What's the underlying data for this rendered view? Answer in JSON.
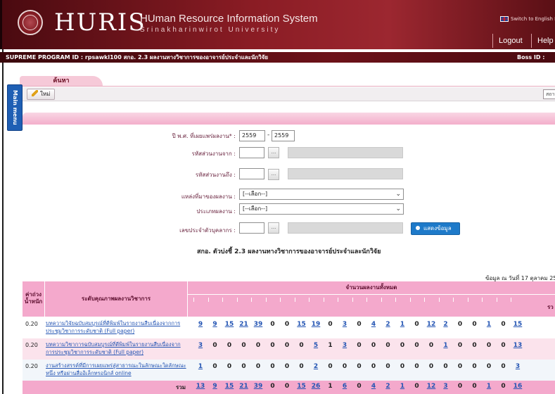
{
  "header": {
    "brand": "HURIS",
    "system_title": "HUman Resource Information System",
    "system_subtitle": "Srinakharinwirot University",
    "language_switch": "Switch to English Language",
    "logout_label": "Logout",
    "help_label": "Help"
  },
  "infobar": {
    "program": "SUPREME  PROGRAM ID : rpsawkl100 สกอ. 2.3 ผลงานทางวิชาการของอาจารย์ประจำและนักวิจัย",
    "boss": "Boss ID :"
  },
  "tab": {
    "label": "ค้นหา"
  },
  "sidemenu": {
    "label": "Main menu"
  },
  "toolbar": {
    "new_label": "ใหม่",
    "status_label": "สถานะ :"
  },
  "form": {
    "year_label": "ปี พ.ศ. ที่เผยแพร่ผลงาน* :",
    "year_from": "2559",
    "year_to": "2559",
    "dash": "-",
    "dept_from_label": "รหัสส่วนงานจาก :",
    "dept_to_label": "รหัสส่วนงานถึง :",
    "source_label": "แหล่งที่มาของผลงาน :",
    "source_value": "[--เลือก--]",
    "type_label": "ประเภทผลงาน :",
    "type_value": "[--เลือก--]",
    "staff_label": "เลขประจำตัวบุคลากร :",
    "dots": "...",
    "show_button": "แสดงข้อมูล"
  },
  "report": {
    "title": "สกอ. ตัวบ่งชี้ 2.3 ผลงานทางวิชาการของอาจารย์ประจำและนักวิจัย",
    "date": "ข้อมูล ณ วันที่ 17 ตุลาคม 25",
    "col_weight": "ค่าถ่วงน้ำหนัก",
    "col_quality": "ระดับคุณภาพผลงานวิชาการ",
    "col_count": "จำนวนผลงานทั้งหมด",
    "col_sum": "รว",
    "sum_label": "รวม",
    "rows": [
      {
        "score": "0.20",
        "desc": "บทความวิจัยฉบับสมบูรณ์ที่ตีพิมพ์ในรายงานสืบเนื่องจากการประชุมวิชาการระดับชาติ (Full paper)",
        "values": [
          "9",
          "9",
          "15",
          "21",
          "39",
          "0",
          "0",
          "15",
          "19",
          "0",
          "3",
          "0",
          "4",
          "2",
          "1",
          "0",
          "12",
          "2",
          "0",
          "0",
          "1",
          "0",
          "15"
        ]
      },
      {
        "score": "0.20",
        "desc": "บทความวิชาการฉบับสมบูรณ์ที่ตีพิมพ์ในรายงานสืบเนื่องจากการประชุมวิชาการระดับชาติ (Full paper)",
        "values": [
          "3",
          "0",
          "0",
          "0",
          "0",
          "0",
          "0",
          "0",
          "5",
          "1",
          "3",
          "0",
          "0",
          "0",
          "0",
          "0",
          "0",
          "1",
          "0",
          "0",
          "0",
          "0",
          "13"
        ]
      },
      {
        "score": "0.20",
        "desc": "งานสร้างสรรค์ที่มีการเผยแพร่สู่สาธารณะในลักษณะใดลักษณะหนึ่ง หรือผ่านสื่ออิเล็กทรอนิกส์ online",
        "values": [
          "1",
          "0",
          "0",
          "0",
          "0",
          "0",
          "0",
          "0",
          "2",
          "0",
          "0",
          "0",
          "0",
          "0",
          "0",
          "0",
          "0",
          "0",
          "0",
          "0",
          "0",
          "0",
          "3"
        ]
      }
    ],
    "sums": [
      "13",
      "9",
      "15",
      "21",
      "39",
      "0",
      "0",
      "15",
      "26",
      "1",
      "6",
      "0",
      "4",
      "2",
      "1",
      "0",
      "12",
      "3",
      "0",
      "0",
      "1",
      "0",
      "16"
    ]
  }
}
